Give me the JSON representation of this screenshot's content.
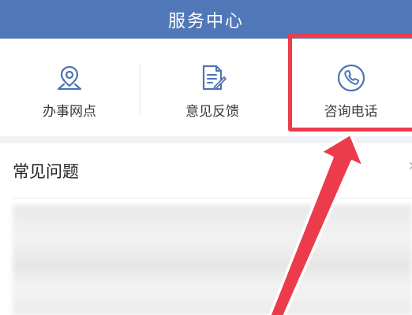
{
  "header": {
    "title": "服务中心"
  },
  "services": [
    {
      "label": "办事网点",
      "icon": "location-pin-icon"
    },
    {
      "label": "意见反馈",
      "icon": "feedback-document-icon"
    },
    {
      "label": "咨询电话",
      "icon": "phone-icon"
    }
  ],
  "faq": {
    "title": "常见问题",
    "chevron": "›"
  },
  "colors": {
    "header_bg": "#5078b9",
    "icon_blue": "#4c74b4",
    "highlight_red": "#ec3b4b"
  }
}
